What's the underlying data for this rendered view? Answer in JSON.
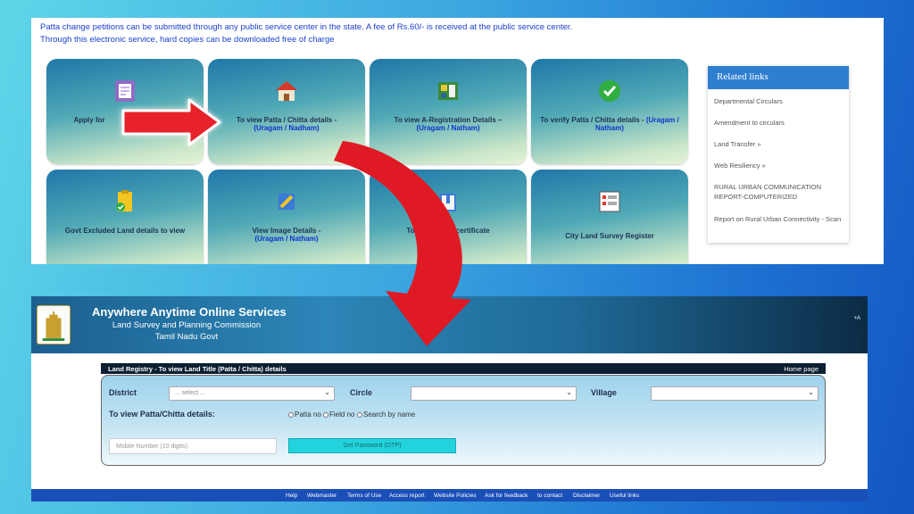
{
  "top": {
    "intro_line1": "Patta change petitions can be submitted through any public service center in the state. A fee of Rs.60/- is received at the public service center.",
    "intro_line2": "Through this electronic service, hard copies can be downloaded free of charge",
    "tiles": [
      {
        "label": "Apply for",
        "sub": "",
        "icon": "form-icon"
      },
      {
        "label": "To view Patta / Chitta details -",
        "sub": "(Uragam / Nadham)",
        "icon": "house-icon"
      },
      {
        "label": "To view A-Registration Details –",
        "sub": "(Uragam / Natham)",
        "icon": "map-document-icon"
      },
      {
        "label": "To verify Patta / Chitta details -",
        "sub": "(Uragam / Natham)",
        "icon": "checkmark-icon"
      },
      {
        "label": "Govt Excluded Land details to view",
        "sub": "",
        "icon": "clipboard-check-icon"
      },
      {
        "label": "View Image Details -",
        "sub": "(Uragam / Natham)",
        "icon": "pencil-image-icon"
      },
      {
        "label": "To vie          y of the certificate",
        "sub": "",
        "icon": "building-icon"
      },
      {
        "label": "City Land Survey Register",
        "sub": "",
        "icon": "register-icon"
      }
    ],
    "related": {
      "title": "Related links",
      "links": [
        "Departmental Circulars",
        "Amendment to circulars",
        "Land Transfer »",
        "Web Resiliency »",
        "RURAL URBAN COMMUNICATION REPORT-COMPUTERIZED",
        "Report on Rural Urban Connectivity - Scan"
      ]
    }
  },
  "bottom": {
    "title": "Anywhere Anytime Online Services",
    "subtitle1": "Land Survey and Planning Commission",
    "subtitle2": "Tamil Nadu Govt",
    "font_toggle": "+A",
    "bar_title": "Land Registry - To view Land Title (Patta / Chitta) details",
    "home": "Home page",
    "form": {
      "district_label": "District",
      "district_value": "... select ...",
      "circle_label": "Circle",
      "village_label": "Village",
      "view_label": "To view Patta/Chitta details:",
      "radio1": "Patta no",
      "radio2": "Field no",
      "radio3": "Search by name",
      "mobile_placeholder": "Mobile Number (10 digits)",
      "otp_button": "Get Password (OTP)"
    },
    "footer": [
      "Help",
      "Webmaster",
      "Terms of Use",
      "Access report",
      "Website Policies",
      "Ask for feedback",
      "to contact",
      "Disclaimer",
      "Useful links"
    ]
  },
  "colors": {
    "accent": "#e8202a",
    "banner": "#1b5f8f",
    "otp": "#22d3dd"
  }
}
